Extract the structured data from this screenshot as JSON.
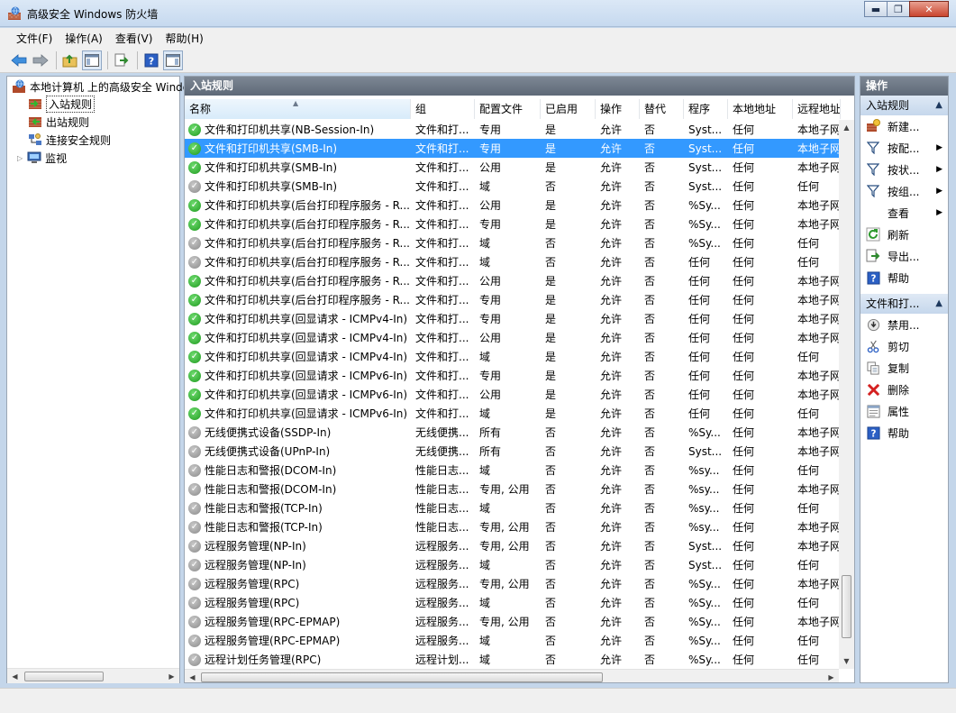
{
  "window": {
    "title": "高级安全 Windows 防火墙"
  },
  "menu": [
    "文件(F)",
    "操作(A)",
    "查看(V)",
    "帮助(H)"
  ],
  "tree": {
    "root": "本地计算机 上的高级安全 Windows 防火墙",
    "items": [
      "入站规则",
      "出站规则",
      "连接安全规则",
      "监视"
    ]
  },
  "list": {
    "header": "入站规则",
    "columns": [
      "名称",
      "组",
      "配置文件",
      "已启用",
      "操作",
      "替代",
      "程序",
      "本地地址",
      "远程地址"
    ],
    "rows": [
      {
        "name": "文件和打印机共享(NB-Session-In)",
        "group": "文件和打...",
        "profile": "专用",
        "enabled": "是",
        "action": "允许",
        "override": "否",
        "program": "Syst...",
        "local": "任何",
        "remote": "本地子网",
        "on": true
      },
      {
        "name": "文件和打印机共享(SMB-In)",
        "group": "文件和打...",
        "profile": "专用",
        "enabled": "是",
        "action": "允许",
        "override": "否",
        "program": "Syst...",
        "local": "任何",
        "remote": "本地子网",
        "on": true,
        "selected": true
      },
      {
        "name": "文件和打印机共享(SMB-In)",
        "group": "文件和打...",
        "profile": "公用",
        "enabled": "是",
        "action": "允许",
        "override": "否",
        "program": "Syst...",
        "local": "任何",
        "remote": "本地子网",
        "on": true
      },
      {
        "name": "文件和打印机共享(SMB-In)",
        "group": "文件和打...",
        "profile": "域",
        "enabled": "否",
        "action": "允许",
        "override": "否",
        "program": "Syst...",
        "local": "任何",
        "remote": "任何",
        "on": false
      },
      {
        "name": "文件和打印机共享(后台打印程序服务 - R...",
        "group": "文件和打...",
        "profile": "公用",
        "enabled": "是",
        "action": "允许",
        "override": "否",
        "program": "%Sy...",
        "local": "任何",
        "remote": "本地子网",
        "on": true
      },
      {
        "name": "文件和打印机共享(后台打印程序服务 - R...",
        "group": "文件和打...",
        "profile": "专用",
        "enabled": "是",
        "action": "允许",
        "override": "否",
        "program": "%Sy...",
        "local": "任何",
        "remote": "本地子网",
        "on": true
      },
      {
        "name": "文件和打印机共享(后台打印程序服务 - R...",
        "group": "文件和打...",
        "profile": "域",
        "enabled": "否",
        "action": "允许",
        "override": "否",
        "program": "%Sy...",
        "local": "任何",
        "remote": "任何",
        "on": false
      },
      {
        "name": "文件和打印机共享(后台打印程序服务 - R...",
        "group": "文件和打...",
        "profile": "域",
        "enabled": "否",
        "action": "允许",
        "override": "否",
        "program": "任何",
        "local": "任何",
        "remote": "任何",
        "on": false
      },
      {
        "name": "文件和打印机共享(后台打印程序服务 - R...",
        "group": "文件和打...",
        "profile": "公用",
        "enabled": "是",
        "action": "允许",
        "override": "否",
        "program": "任何",
        "local": "任何",
        "remote": "本地子网",
        "on": true
      },
      {
        "name": "文件和打印机共享(后台打印程序服务 - R...",
        "group": "文件和打...",
        "profile": "专用",
        "enabled": "是",
        "action": "允许",
        "override": "否",
        "program": "任何",
        "local": "任何",
        "remote": "本地子网",
        "on": true
      },
      {
        "name": "文件和打印机共享(回显请求 - ICMPv4-In)",
        "group": "文件和打...",
        "profile": "专用",
        "enabled": "是",
        "action": "允许",
        "override": "否",
        "program": "任何",
        "local": "任何",
        "remote": "本地子网",
        "on": true
      },
      {
        "name": "文件和打印机共享(回显请求 - ICMPv4-In)",
        "group": "文件和打...",
        "profile": "公用",
        "enabled": "是",
        "action": "允许",
        "override": "否",
        "program": "任何",
        "local": "任何",
        "remote": "本地子网",
        "on": true
      },
      {
        "name": "文件和打印机共享(回显请求 - ICMPv4-In)",
        "group": "文件和打...",
        "profile": "域",
        "enabled": "是",
        "action": "允许",
        "override": "否",
        "program": "任何",
        "local": "任何",
        "remote": "任何",
        "on": true
      },
      {
        "name": "文件和打印机共享(回显请求 - ICMPv6-In)",
        "group": "文件和打...",
        "profile": "专用",
        "enabled": "是",
        "action": "允许",
        "override": "否",
        "program": "任何",
        "local": "任何",
        "remote": "本地子网",
        "on": true
      },
      {
        "name": "文件和打印机共享(回显请求 - ICMPv6-In)",
        "group": "文件和打...",
        "profile": "公用",
        "enabled": "是",
        "action": "允许",
        "override": "否",
        "program": "任何",
        "local": "任何",
        "remote": "本地子网",
        "on": true
      },
      {
        "name": "文件和打印机共享(回显请求 - ICMPv6-In)",
        "group": "文件和打...",
        "profile": "域",
        "enabled": "是",
        "action": "允许",
        "override": "否",
        "program": "任何",
        "local": "任何",
        "remote": "任何",
        "on": true
      },
      {
        "name": "无线便携式设备(SSDP-In)",
        "group": "无线便携...",
        "profile": "所有",
        "enabled": "否",
        "action": "允许",
        "override": "否",
        "program": "%Sy...",
        "local": "任何",
        "remote": "本地子网",
        "on": false
      },
      {
        "name": "无线便携式设备(UPnP-In)",
        "group": "无线便携...",
        "profile": "所有",
        "enabled": "否",
        "action": "允许",
        "override": "否",
        "program": "Syst...",
        "local": "任何",
        "remote": "本地子网",
        "on": false
      },
      {
        "name": "性能日志和警报(DCOM-In)",
        "group": "性能日志...",
        "profile": "域",
        "enabled": "否",
        "action": "允许",
        "override": "否",
        "program": "%sy...",
        "local": "任何",
        "remote": "任何",
        "on": false
      },
      {
        "name": "性能日志和警报(DCOM-In)",
        "group": "性能日志...",
        "profile": "专用, 公用",
        "enabled": "否",
        "action": "允许",
        "override": "否",
        "program": "%sy...",
        "local": "任何",
        "remote": "本地子网",
        "on": false
      },
      {
        "name": "性能日志和警报(TCP-In)",
        "group": "性能日志...",
        "profile": "域",
        "enabled": "否",
        "action": "允许",
        "override": "否",
        "program": "%sy...",
        "local": "任何",
        "remote": "任何",
        "on": false
      },
      {
        "name": "性能日志和警报(TCP-In)",
        "group": "性能日志...",
        "profile": "专用, 公用",
        "enabled": "否",
        "action": "允许",
        "override": "否",
        "program": "%sy...",
        "local": "任何",
        "remote": "本地子网",
        "on": false
      },
      {
        "name": "远程服务管理(NP-In)",
        "group": "远程服务...",
        "profile": "专用, 公用",
        "enabled": "否",
        "action": "允许",
        "override": "否",
        "program": "Syst...",
        "local": "任何",
        "remote": "本地子网",
        "on": false
      },
      {
        "name": "远程服务管理(NP-In)",
        "group": "远程服务...",
        "profile": "域",
        "enabled": "否",
        "action": "允许",
        "override": "否",
        "program": "Syst...",
        "local": "任何",
        "remote": "任何",
        "on": false
      },
      {
        "name": "远程服务管理(RPC)",
        "group": "远程服务...",
        "profile": "专用, 公用",
        "enabled": "否",
        "action": "允许",
        "override": "否",
        "program": "%Sy...",
        "local": "任何",
        "remote": "本地子网",
        "on": false
      },
      {
        "name": "远程服务管理(RPC)",
        "group": "远程服务...",
        "profile": "域",
        "enabled": "否",
        "action": "允许",
        "override": "否",
        "program": "%Sy...",
        "local": "任何",
        "remote": "任何",
        "on": false
      },
      {
        "name": "远程服务管理(RPC-EPMAP)",
        "group": "远程服务...",
        "profile": "专用, 公用",
        "enabled": "否",
        "action": "允许",
        "override": "否",
        "program": "%Sy...",
        "local": "任何",
        "remote": "本地子网",
        "on": false
      },
      {
        "name": "远程服务管理(RPC-EPMAP)",
        "group": "远程服务...",
        "profile": "域",
        "enabled": "否",
        "action": "允许",
        "override": "否",
        "program": "%Sy...",
        "local": "任何",
        "remote": "任何",
        "on": false
      },
      {
        "name": "远程计划任务管理(RPC)",
        "group": "远程计划...",
        "profile": "域",
        "enabled": "否",
        "action": "允许",
        "override": "否",
        "program": "%Sy...",
        "local": "任何",
        "remote": "任何",
        "on": false
      }
    ]
  },
  "actions": {
    "header": "操作",
    "section1": {
      "title": "入站规则",
      "items": [
        {
          "label": "新建...",
          "icon": "new-rule-icon",
          "sub": false
        },
        {
          "label": "按配...",
          "icon": "filter-icon",
          "sub": true
        },
        {
          "label": "按状...",
          "icon": "filter-icon",
          "sub": true
        },
        {
          "label": "按组...",
          "icon": "filter-icon",
          "sub": true
        },
        {
          "label": "查看",
          "icon": "",
          "sub": true
        },
        {
          "label": "刷新",
          "icon": "refresh-icon",
          "sub": false
        },
        {
          "label": "导出...",
          "icon": "export-icon",
          "sub": false
        },
        {
          "label": "帮助",
          "icon": "help-icon",
          "sub": false
        }
      ]
    },
    "section2": {
      "title": "文件和打...",
      "items": [
        {
          "label": "禁用...",
          "icon": "disable-icon"
        },
        {
          "label": "剪切",
          "icon": "cut-icon"
        },
        {
          "label": "复制",
          "icon": "copy-icon"
        },
        {
          "label": "删除",
          "icon": "delete-icon"
        },
        {
          "label": "属性",
          "icon": "properties-icon"
        },
        {
          "label": "帮助",
          "icon": "help-icon"
        }
      ]
    }
  }
}
